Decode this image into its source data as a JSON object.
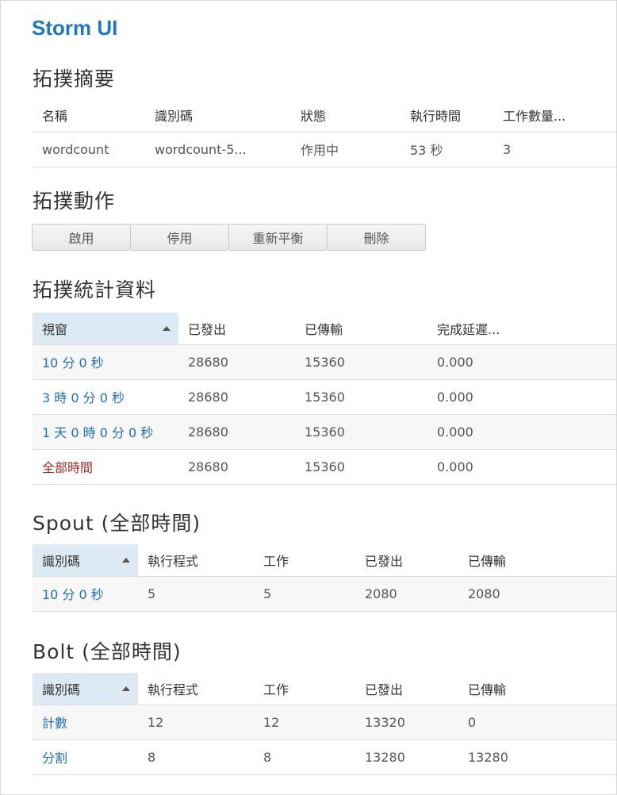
{
  "app": {
    "title": "Storm UI"
  },
  "summary": {
    "heading": "拓撲摘要",
    "columns": [
      "名稱",
      "識別碼",
      "狀態",
      "執行時間",
      "工作數量..."
    ],
    "row": [
      "wordcount",
      "wordcount-5...",
      "作用中",
      "53 秒",
      "3"
    ]
  },
  "actions": {
    "heading": "拓撲動作",
    "buttons": [
      "啟用",
      "停用",
      "重新平衡",
      "刪除"
    ]
  },
  "stats": {
    "heading": "拓撲統計資料",
    "columns": [
      "視窗",
      "已發出",
      "已傳輸",
      "完成延遲..."
    ],
    "rows": [
      [
        "10 分 0 秒",
        "28680",
        "15360",
        "0.000"
      ],
      [
        "3 時 0 分 0 秒",
        "28680",
        "15360",
        "0.000"
      ],
      [
        "1 天 0 時 0 分 0 秒",
        "28680",
        "15360",
        "0.000"
      ],
      [
        "全部時間",
        "28680",
        "15360",
        "0.000"
      ]
    ]
  },
  "spouts": {
    "heading": "Spout (全部時間)",
    "columns": [
      "識別碼",
      "執行程式",
      "工作",
      "已發出",
      "已傳輸"
    ],
    "rows": [
      [
        "10 分 0 秒",
        "5",
        "5",
        "2080",
        "2080"
      ]
    ]
  },
  "bolts": {
    "heading": "Bolt (全部時間)",
    "columns": [
      "識別碼",
      "執行程式",
      "工作",
      "已發出",
      "已傳輸"
    ],
    "rows": [
      [
        "計數",
        "12",
        "12",
        "13320",
        "0"
      ],
      [
        "分割",
        "8",
        "8",
        "13280",
        "13280"
      ]
    ]
  },
  "colors": {
    "brand": "#1f78c1",
    "link": "#1f6fb5",
    "link_alltime": "#a52a2a",
    "sorted_header": "#dde9f3"
  }
}
